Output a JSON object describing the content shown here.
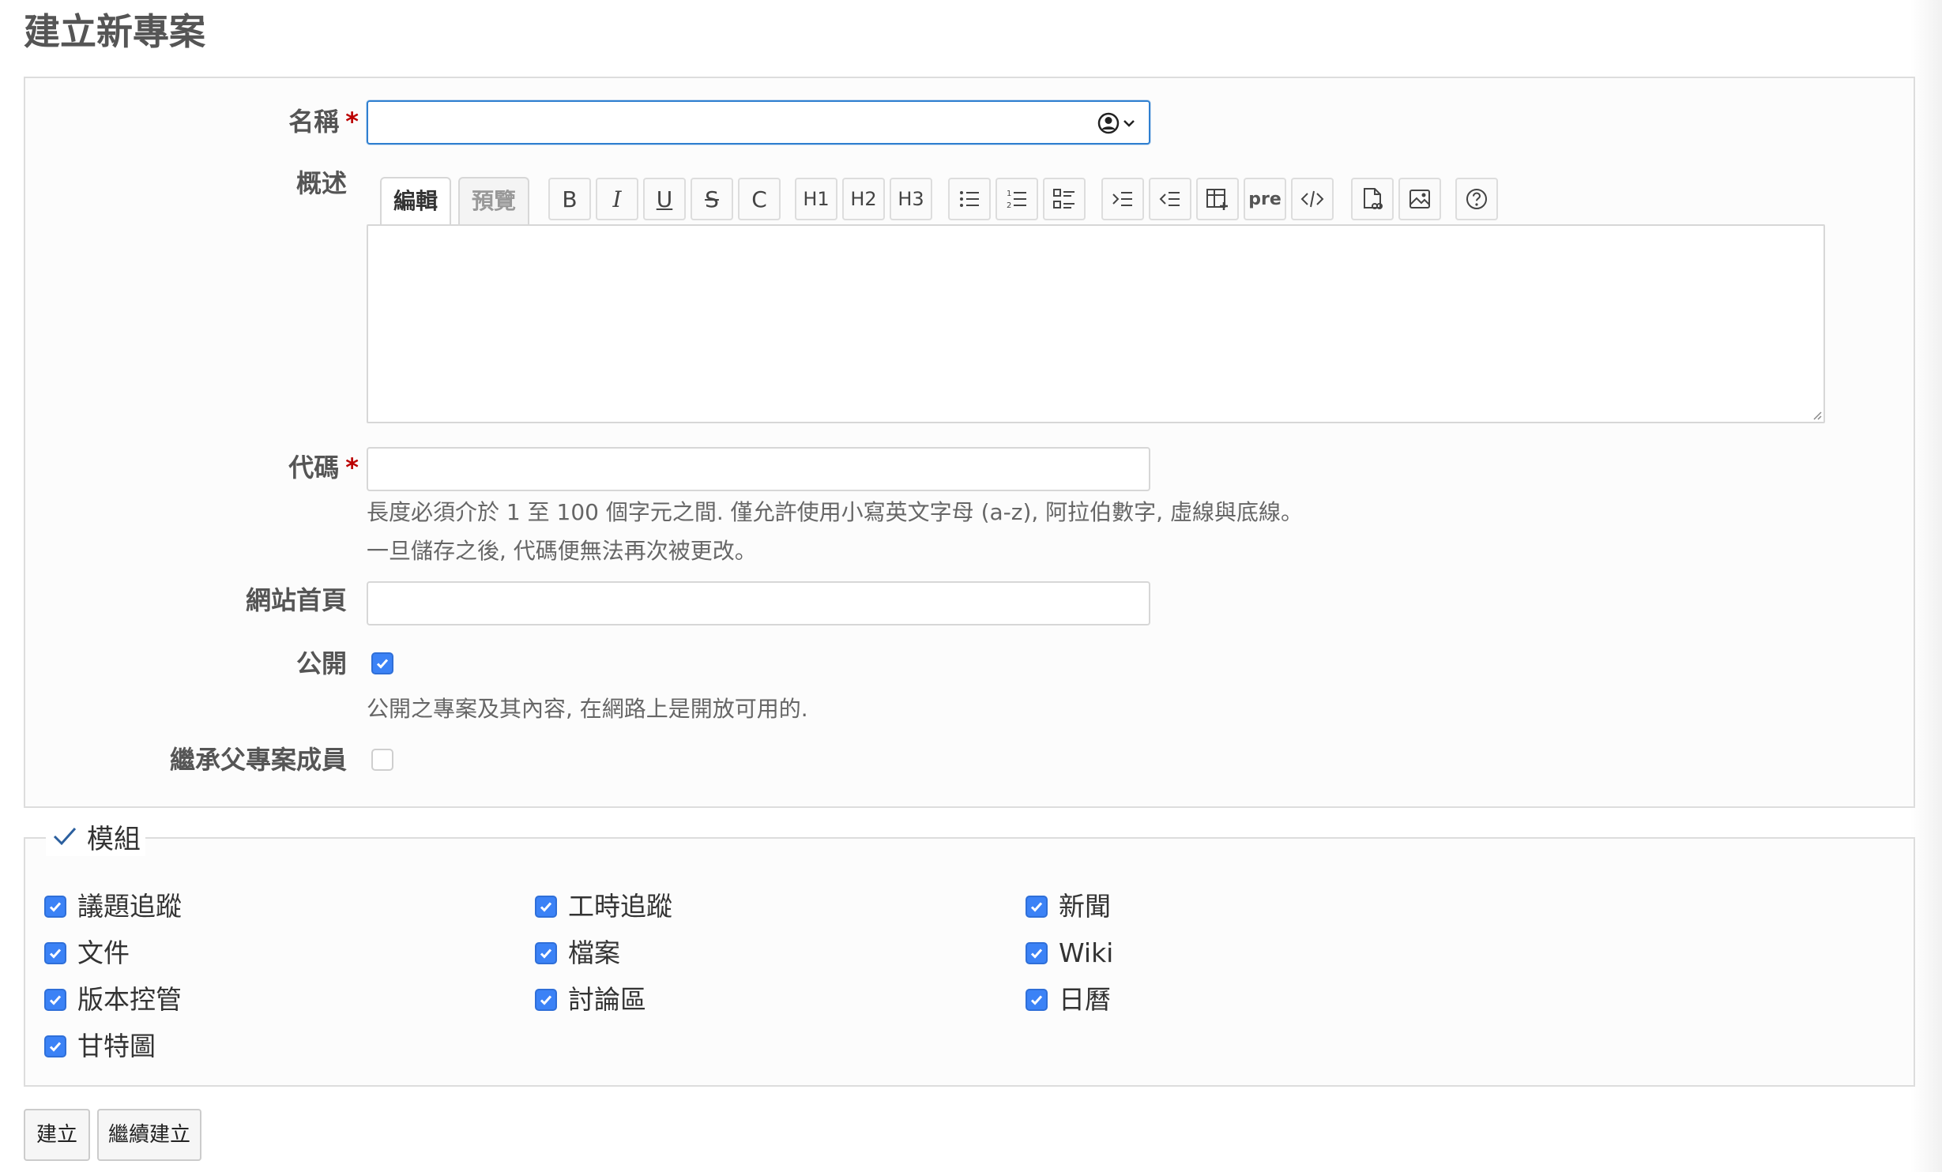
{
  "page": {
    "title": "建立新專案"
  },
  "form": {
    "name": {
      "label": "名稱",
      "required_mark": "*",
      "value": ""
    },
    "description": {
      "label": "概述",
      "tabs": {
        "edit": "編輯",
        "preview": "預覽"
      },
      "toolbar": {
        "bold": "B",
        "italic": "I",
        "underline": "U",
        "strike": "S",
        "code_inline": "C",
        "h1": "H1",
        "h2": "H2",
        "h3": "H3",
        "pre": "pre"
      },
      "value": ""
    },
    "identifier": {
      "label": "代碼",
      "required_mark": "*",
      "value": "",
      "hint1": "長度必須介於 1 至 100 個字元之間. 僅允許使用小寫英文字母 (a-z), 阿拉伯數字, 虛線與底線。",
      "hint2": "一旦儲存之後, 代碼便無法再次被更改。"
    },
    "homepage": {
      "label": "網站首頁",
      "value": ""
    },
    "public": {
      "label": "公開",
      "checked": true,
      "hint": "公開之專案及其內容, 在網路上是開放可用的."
    },
    "inherit_members": {
      "label": "繼承父專案成員",
      "checked": false
    }
  },
  "modules": {
    "legend": "模組",
    "items": [
      {
        "label": "議題追蹤",
        "checked": true
      },
      {
        "label": "工時追蹤",
        "checked": true
      },
      {
        "label": "新聞",
        "checked": true
      },
      {
        "label": "文件",
        "checked": true
      },
      {
        "label": "檔案",
        "checked": true
      },
      {
        "label": "Wiki",
        "checked": true
      },
      {
        "label": "版本控管",
        "checked": true
      },
      {
        "label": "討論區",
        "checked": true
      },
      {
        "label": "日曆",
        "checked": true
      },
      {
        "label": "甘特圖",
        "checked": true
      }
    ]
  },
  "actions": {
    "create": "建立",
    "create_continue": "繼續建立"
  },
  "colors": {
    "accent": "#3b82f6",
    "required": "#bb0000",
    "focus": "#2f7fd0"
  }
}
